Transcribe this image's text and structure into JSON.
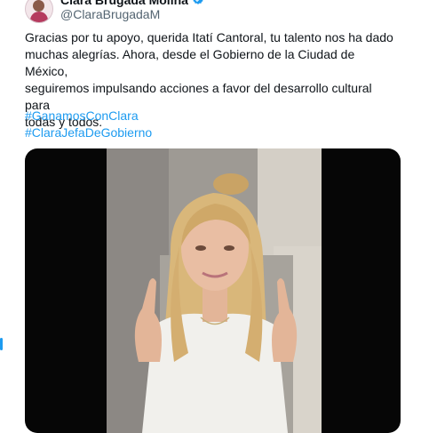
{
  "author": {
    "display_name": "Clara Brugada Molina",
    "handle": "@ClaraBrugadaM",
    "verified": true
  },
  "tweet": {
    "text_lines": [
      "Gracias por tu apoyo, querida Itatí Cantoral, tu talento nos ha dado",
      "muchas alegrías. Ahora,  desde el Gobierno de la Ciudad de México,",
      "seguiremos impulsando acciones a favor del desarrollo cultural para",
      "todas y todos."
    ],
    "hashtags": [
      "#GanamosConClara",
      "#ClaraJefaDeGobierno"
    ]
  },
  "colors": {
    "link": "#1d9bf0",
    "text": "#0f1419",
    "secondary": "#536471",
    "media_bg": "#060606"
  }
}
